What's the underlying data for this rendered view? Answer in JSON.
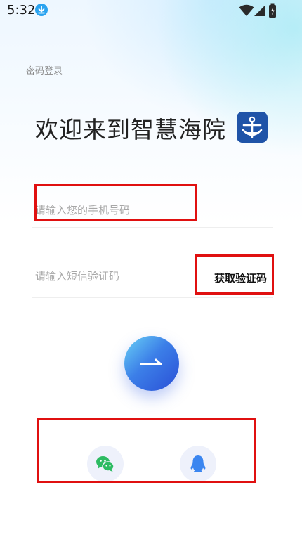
{
  "status_bar": {
    "time": "5:32"
  },
  "header": {
    "password_login_link": "密码登录"
  },
  "welcome": {
    "title": "欢迎来到智慧海院"
  },
  "form": {
    "phone_placeholder": "请输入您的手机号码",
    "code_placeholder": "请输入短信验证码",
    "get_code_label": "获取验证码"
  },
  "icons": {
    "download": "download-icon",
    "wifi": "wifi-icon",
    "signal": "signal-icon",
    "battery": "battery-icon",
    "logo": "anchor-logo-icon",
    "submit": "arrow-right-icon",
    "wechat": "wechat-icon",
    "qq": "qq-icon"
  },
  "colors": {
    "accent_blue": "#3c7fe8",
    "logo_blue": "#1f54a8",
    "wechat_green": "#2dbb62",
    "qq_blue": "#3b86f0",
    "highlight_red": "#e01010"
  }
}
